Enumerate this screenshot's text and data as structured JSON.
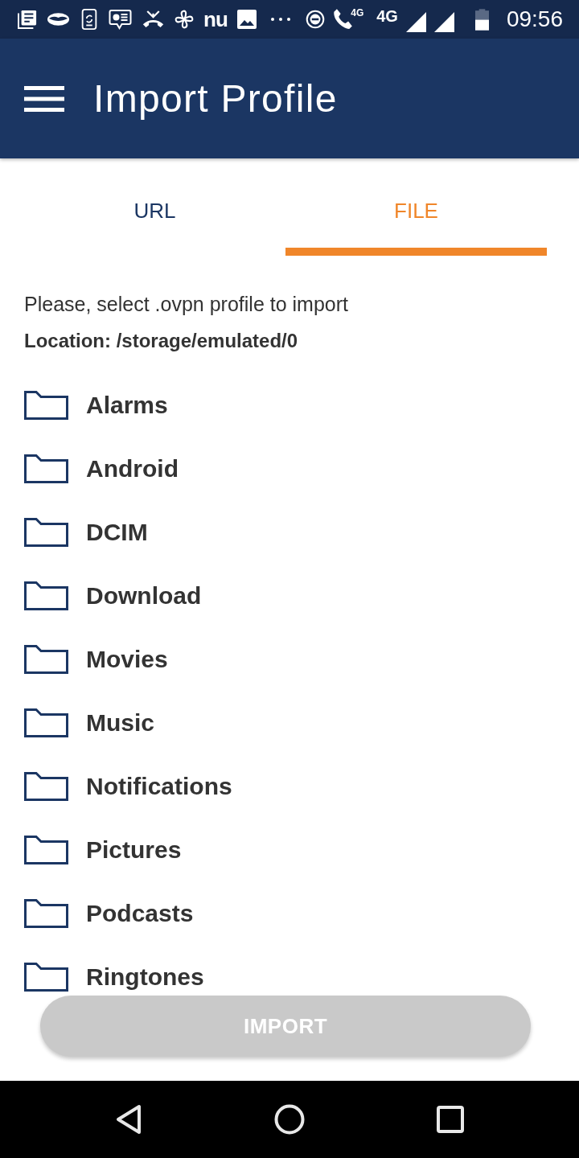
{
  "status_bar": {
    "app_logo": "nu",
    "call_badge": "4G",
    "network_type": "4G",
    "time": "09:56"
  },
  "app_bar": {
    "title": "Import Profile"
  },
  "tabs": [
    {
      "label": "URL",
      "selected": false
    },
    {
      "label": "FILE",
      "selected": true
    }
  ],
  "file_browser": {
    "instruction": "Please, select .ovpn profile to import",
    "location": "Location: /storage/emulated/0",
    "folders": [
      {
        "name": "Alarms"
      },
      {
        "name": "Android"
      },
      {
        "name": "DCIM"
      },
      {
        "name": "Download"
      },
      {
        "name": "Movies"
      },
      {
        "name": "Music"
      },
      {
        "name": "Notifications"
      },
      {
        "name": "Pictures"
      },
      {
        "name": "Podcasts"
      },
      {
        "name": "Ringtones"
      }
    ]
  },
  "import_button": {
    "label": "IMPORT",
    "disabled": true
  }
}
